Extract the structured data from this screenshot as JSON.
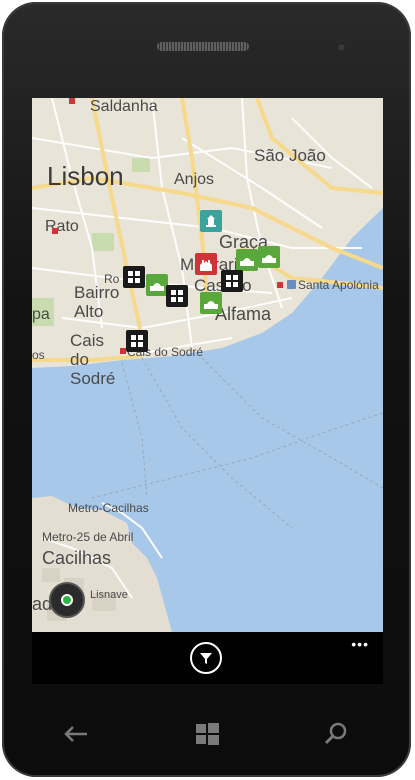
{
  "map": {
    "labels": {
      "saldanha": "Saldanha",
      "lisbon": "Lisbon",
      "anjos": "Anjos",
      "sao_joao": "São João",
      "rato": "Rato",
      "graca": "Graça",
      "mouraria": "Mouraria",
      "castelo": "Castelo",
      "alfama": "Alfama",
      "bairro_alto": "Bairro Alto",
      "santa_apolonia": "Santa Apolónia",
      "cais_do_sodre": "Cais do Sodré",
      "cais_do_sodre_station": "Cais do Sodré",
      "metro_cacilhas": "Metro-Cacilhas",
      "metro_25_abril": "Metro-25 de Abril",
      "cacilhas": "Cacilhas",
      "lisnave": "Lisnave",
      "rossio_partial": "Ro",
      "pa_partial": "pa",
      "os_partial": "os",
      "ada_partial": "ada"
    },
    "colors": {
      "land": "#e9e4d8",
      "water": "#a7c8e8",
      "road_major": "#f6d98a",
      "road_minor": "#ffffff",
      "park": "#c9dcb0",
      "pin_museum": "#1a1a1a",
      "pin_park": "#5aa83c",
      "pin_church": "#d13438",
      "pin_landmark": "#3aa39b"
    },
    "pins": [
      {
        "type": "landmark",
        "icon": "monument-icon"
      },
      {
        "type": "church",
        "icon": "church-icon"
      },
      {
        "type": "park",
        "icon": "mosque-icon"
      },
      {
        "type": "park",
        "icon": "mosque-icon"
      },
      {
        "type": "park",
        "icon": "mosque-icon"
      },
      {
        "type": "park",
        "icon": "mosque-icon"
      },
      {
        "type": "museum",
        "icon": "window-grid-icon"
      },
      {
        "type": "museum",
        "icon": "window-grid-icon"
      },
      {
        "type": "museum",
        "icon": "window-grid-icon"
      },
      {
        "type": "museum",
        "icon": "window-grid-icon"
      }
    ]
  },
  "appbar": {
    "more_label": "•••",
    "filter_icon": "filter-icon"
  },
  "hardware": {
    "back_icon": "back-arrow-icon",
    "start_icon": "windows-logo-icon",
    "search_icon": "search-icon"
  }
}
